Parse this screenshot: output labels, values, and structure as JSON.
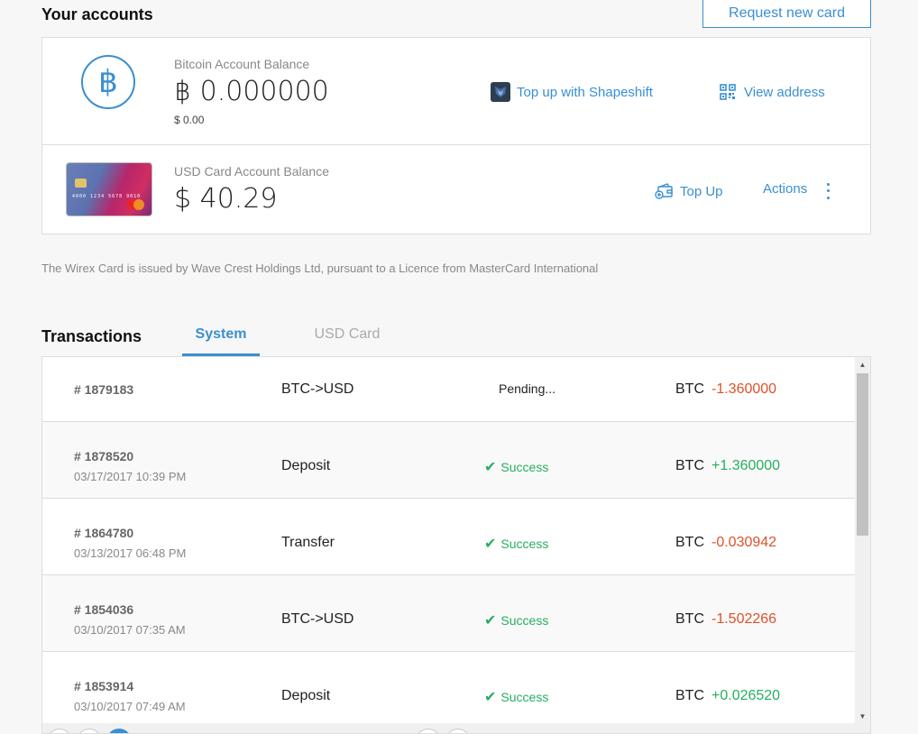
{
  "header": {
    "title": "Your accounts",
    "request_label": "Request new card"
  },
  "bitcoin": {
    "symbol": "฿",
    "label": "Bitcoin Account Balance",
    "balance": "฿ 0.000000",
    "sub": "$ 0.00",
    "action1": "Top up with Shapeshift",
    "action2": "View address"
  },
  "usd_card": {
    "label": "USD Card Account Balance",
    "balance": "$ 40.29",
    "card_number": "4000 1234 5678 9010",
    "action1": "Top Up",
    "action2": "Actions"
  },
  "disclaimer": "The Wirex Card is issued by Wave Crest Holdings Ltd, pursuant to a Licence from MasterCard International",
  "transactions": {
    "title": "Transactions",
    "tabs": [
      "System",
      "USD Card"
    ],
    "rows": [
      {
        "id": "# 1879183",
        "date": "",
        "type": "BTC->USD",
        "status": "Pending...",
        "currency": "BTC",
        "amount": "-1.360000"
      },
      {
        "id": "# 1878520",
        "date": "03/17/2017 10:39 PM",
        "type": "Deposit",
        "status": "Success",
        "currency": "BTC",
        "amount": "+1.360000"
      },
      {
        "id": "# 1864780",
        "date": "03/13/2017 06:48 PM",
        "type": "Transfer",
        "status": "Success",
        "currency": "BTC",
        "amount": "-0.030942"
      },
      {
        "id": "# 1854036",
        "date": "03/10/2017 07:35 AM",
        "type": "BTC->USD",
        "status": "Success",
        "currency": "BTC",
        "amount": "-1.502266"
      },
      {
        "id": "# 1853914",
        "date": "03/10/2017 07:49 AM",
        "type": "Deposit",
        "status": "Success",
        "currency": "BTC",
        "amount": "+0.026520"
      }
    ]
  },
  "colors": {
    "accent": "#3a8fd0",
    "positive": "#27ae60",
    "negative": "#e0502a"
  }
}
